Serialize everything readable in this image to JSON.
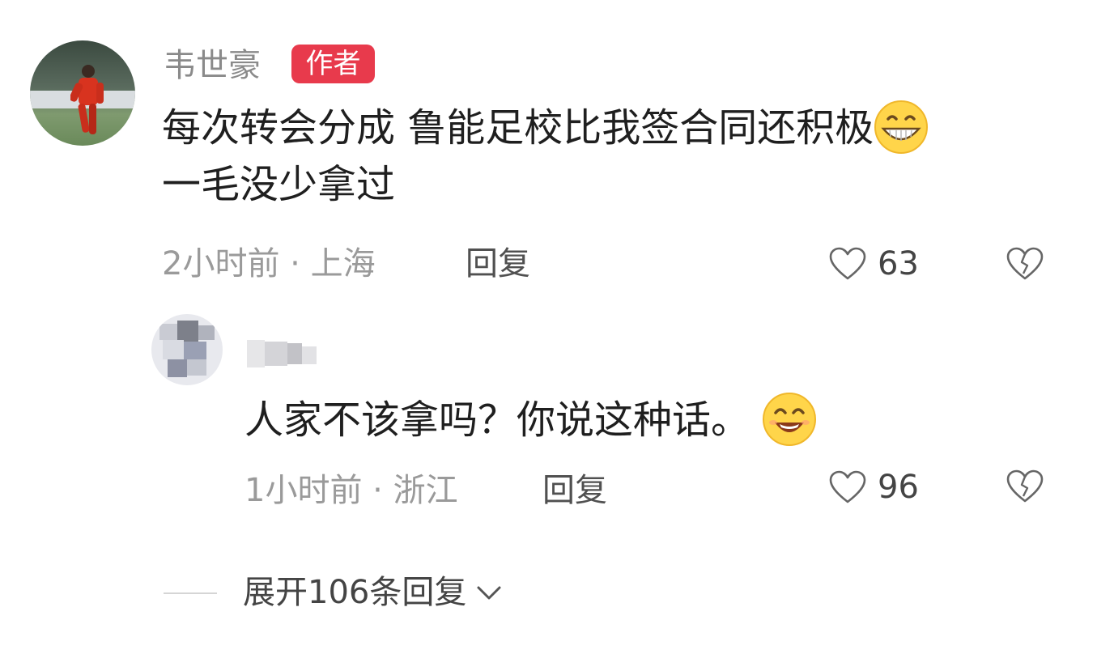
{
  "main_comment": {
    "author": "韦世豪",
    "badge": "作者",
    "text_line1": "每次转会分成 鲁能足校比我签合同还积极",
    "text_line2": "一毛没少拿过",
    "emoji": "grinning-face-icon",
    "time_location": "2小时前 · 上海",
    "reply_label": "回复",
    "likes": "63"
  },
  "reply_comment": {
    "text": "人家不该拿吗？你说这种话。",
    "emoji": "smiling-face-icon",
    "time_location": "1小时前 · 浙江",
    "reply_label": "回复",
    "likes": "96"
  },
  "expand": {
    "label": "展开106条回复"
  },
  "colors": {
    "badge_bg": "#e83a4c",
    "meta_text": "#9a9a9a"
  }
}
